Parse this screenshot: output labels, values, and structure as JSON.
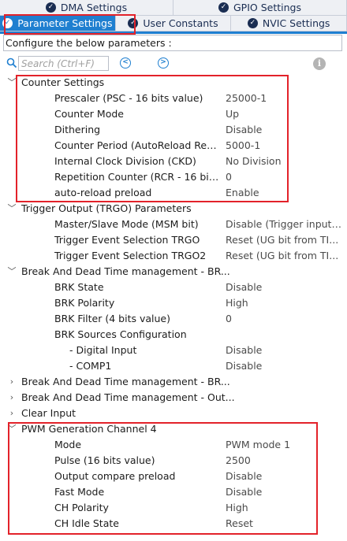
{
  "tabs_row1": [
    {
      "label": "DMA Settings",
      "icon": "check-circle-icon"
    },
    {
      "label": "GPIO Settings",
      "icon": "check-circle-icon"
    }
  ],
  "tabs_row2": [
    {
      "label": "Parameter Settings",
      "icon": "check-circle-icon",
      "active": true
    },
    {
      "label": "User Constants",
      "icon": "check-circle-icon"
    },
    {
      "label": "NVIC Settings",
      "icon": "check-circle-icon"
    }
  ],
  "config_label": "Configure the below parameters :",
  "search": {
    "placeholder": "Search (Ctrl+F)"
  },
  "colors": {
    "accent": "#1f7fd0",
    "highlight": "#e3222a",
    "tab_bg": "#eef0f4"
  },
  "counter_settings": {
    "label": "Counter Settings",
    "params": [
      {
        "name": "Prescaler (PSC - 16 bits value)",
        "value": "25000-1"
      },
      {
        "name": "Counter Mode",
        "value": "Up"
      },
      {
        "name": "Dithering",
        "value": "Disable"
      },
      {
        "name": "Counter Period (AutoReload Regist...",
        "value": "5000-1"
      },
      {
        "name": "Internal Clock Division (CKD)",
        "value": "No Division"
      },
      {
        "name": "Repetition Counter (RCR - 16 bits v...",
        "value": "0"
      },
      {
        "name": "auto-reload preload",
        "value": "Enable"
      }
    ]
  },
  "trgo": {
    "label": "Trigger Output (TRGO) Parameters",
    "params": [
      {
        "name": "Master/Slave Mode (MSM bit)",
        "value": "Disable (Trigger input ..."
      },
      {
        "name": "Trigger Event Selection TRGO",
        "value": "Reset (UG bit from TI..."
      },
      {
        "name": "Trigger Event Selection TRGO2",
        "value": "Reset (UG bit from TI..."
      }
    ]
  },
  "break1": {
    "label": "Break And Dead Time management - BR...",
    "params": [
      {
        "name": "BRK State",
        "value": "Disable"
      },
      {
        "name": "BRK Polarity",
        "value": "High"
      },
      {
        "name": "BRK Filter (4 bits value)",
        "value": "0"
      },
      {
        "name": "BRK Sources Configuration",
        "value": ""
      }
    ],
    "sub_params": [
      {
        "name": "- Digital Input",
        "value": "Disable"
      },
      {
        "name": "- COMP1",
        "value": "Disable"
      }
    ]
  },
  "collapsed_groups": [
    {
      "label": "Break And Dead Time management - BR..."
    },
    {
      "label": "Break And Dead Time management - Out..."
    },
    {
      "label": "Clear Input"
    }
  ],
  "pwm": {
    "label": "PWM Generation Channel 4",
    "params": [
      {
        "name": "Mode",
        "value": "PWM mode 1"
      },
      {
        "name": "Pulse (16 bits value)",
        "value": "2500"
      },
      {
        "name": "Output compare preload",
        "value": "Disable"
      },
      {
        "name": "Fast Mode",
        "value": "Disable"
      },
      {
        "name": "CH Polarity",
        "value": "High"
      },
      {
        "name": "CH Idle State",
        "value": "Reset"
      }
    ]
  }
}
